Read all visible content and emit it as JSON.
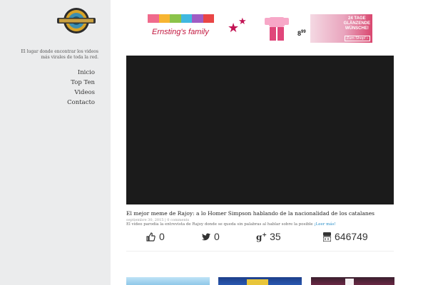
{
  "sidebar": {
    "logo_icon": "site-logo-badge-icon",
    "tagline": "El lugar donde encontrar los videos más virales de toda la red.",
    "menu": [
      {
        "label": "Inicio"
      },
      {
        "label": "Top Ten"
      },
      {
        "label": "Videos"
      },
      {
        "label": "Contacto"
      }
    ]
  },
  "ad": {
    "brand": "Ernsting's family",
    "price": "8",
    "price_cents": "99",
    "promo_line1": "24 TAGE",
    "promo_line2": "GLÄNZENDE",
    "promo_line3": "WÜNSCHE!",
    "cta": "Zum Shop! ›",
    "colors": [
      "#f06a8c",
      "#f7b531",
      "#8bc34a",
      "#40b8e0",
      "#a05cc4",
      "#e94545"
    ]
  },
  "post": {
    "title": "El mejor meme de Rajoy: a lo Homer Simpson hablando de la nacionalidad de los catalanes",
    "meta": "septiembre 30, 2015 | 0 comments",
    "excerpt": "El vídeo parodia la entrevista de Rajoy donde se queda sin palabras al hablar sobre la posible",
    "read_more": "¡Leer más!"
  },
  "stats": {
    "likes": "0",
    "tweets": "0",
    "gplus": "35",
    "youtube_views": "646749"
  },
  "colors": {
    "sidebar_bg": "#ebeced",
    "video_bg": "#1b1b1b",
    "link": "#2a8fc9"
  }
}
